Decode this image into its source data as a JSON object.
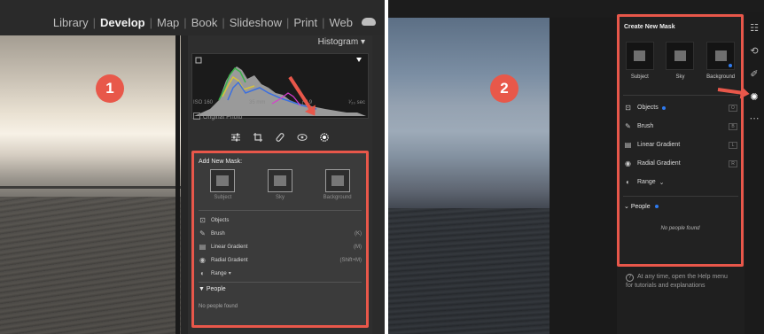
{
  "left_screen": {
    "module_picker": {
      "modules": [
        "Library",
        "Develop",
        "Map",
        "Book",
        "Slideshow",
        "Print",
        "Web"
      ],
      "active": "Develop"
    },
    "step_badge": "1",
    "histogram": {
      "label": "Histogram",
      "iso": "ISO 160",
      "focal": "35 mm",
      "aperture": "ƒ / 9",
      "shutter": "¹⁄₂₀ sec",
      "original_photo": "Original Photo"
    },
    "mask_panel": {
      "title": "Add New Mask:",
      "options": [
        {
          "label": "Subject",
          "icon": "subject-icon"
        },
        {
          "label": "Sky",
          "icon": "sky-icon"
        },
        {
          "label": "Background",
          "icon": "background-icon"
        }
      ],
      "tools": [
        {
          "label": "Objects",
          "shortcut": "",
          "icon": "objects-icon"
        },
        {
          "label": "Brush",
          "shortcut": "(K)",
          "icon": "brush-icon"
        },
        {
          "label": "Linear Gradient",
          "shortcut": "(M)",
          "icon": "linear-gradient-icon"
        },
        {
          "label": "Radial Gradient",
          "shortcut": "(Shift+M)",
          "icon": "radial-gradient-icon"
        },
        {
          "label": "Range",
          "shortcut": "",
          "icon": "range-icon"
        }
      ],
      "people_label": "People",
      "no_people": "No people found"
    }
  },
  "right_screen": {
    "step_badge": "2",
    "mask_panel": {
      "title": "Create New Mask",
      "options": [
        {
          "label": "Subject",
          "icon": "subject-icon"
        },
        {
          "label": "Sky",
          "icon": "sky-icon"
        },
        {
          "label": "Background",
          "icon": "background-icon"
        }
      ],
      "tools": [
        {
          "label": "Objects",
          "shortcut": "O",
          "icon": "objects-icon"
        },
        {
          "label": "Brush",
          "shortcut": "B",
          "icon": "brush-icon"
        },
        {
          "label": "Linear Gradient",
          "shortcut": "L",
          "icon": "linear-gradient-icon"
        },
        {
          "label": "Radial Gradient",
          "shortcut": "R",
          "icon": "radial-gradient-icon"
        },
        {
          "label": "Range",
          "shortcut": "",
          "icon": "range-icon"
        }
      ],
      "people_label": "People",
      "no_people": "No people found"
    },
    "help_text": "At any time, open the Help menu for tutorials and explanations"
  },
  "colors": {
    "highlight": "#e8574a",
    "badge": "#e8584a",
    "blue_dot": "#2e7bf0"
  }
}
